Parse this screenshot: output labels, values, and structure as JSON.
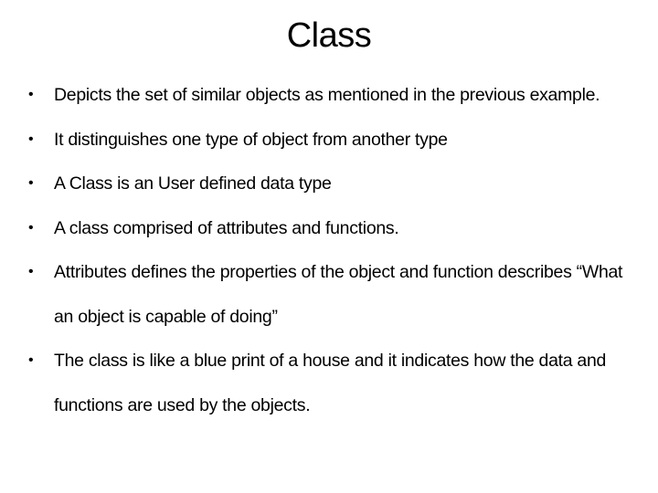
{
  "slide": {
    "title": "Class",
    "bullets": [
      {
        "text": "Depicts the set of similar objects as mentioned in the previous example."
      },
      {
        "text": "It distinguishes one type of object from another type"
      },
      {
        "text": "A Class is an User defined data type"
      },
      {
        "text": "A class comprised of attributes and functions."
      },
      {
        "text": "Attributes defines the properties of the object and function describes “What an object is capable of doing”"
      },
      {
        "text": "The class is like a blue print of a house and it indicates how the data and functions are used by the objects."
      }
    ],
    "bullet_glyph": "•"
  }
}
